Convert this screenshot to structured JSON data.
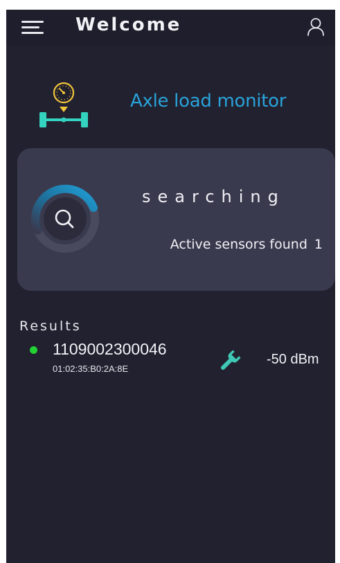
{
  "header": {
    "title": "Welcome",
    "menu_icon": "hamburger-menu-icon",
    "user_icon": "user-icon"
  },
  "brand": {
    "title": "Axle load monitor",
    "logo_icon": "axle-gauge-icon",
    "title_color": "#29a3d9"
  },
  "search": {
    "status": "searching",
    "sensors_label": "Active sensors found",
    "sensors_count": "1",
    "spinner_icon": "magnifier-icon",
    "accent_color": "#1f9fd6"
  },
  "results": {
    "label": "Results",
    "items": [
      {
        "id": "1109002300046",
        "mac": "01:02:35:B0:2A:8E",
        "signal": "-50 dBm",
        "status_color": "#22d134",
        "action_icon": "wrench-icon"
      }
    ]
  },
  "colors": {
    "background": "#222130",
    "card": "#3a3a4f",
    "wrench": "#3fc8b6"
  }
}
